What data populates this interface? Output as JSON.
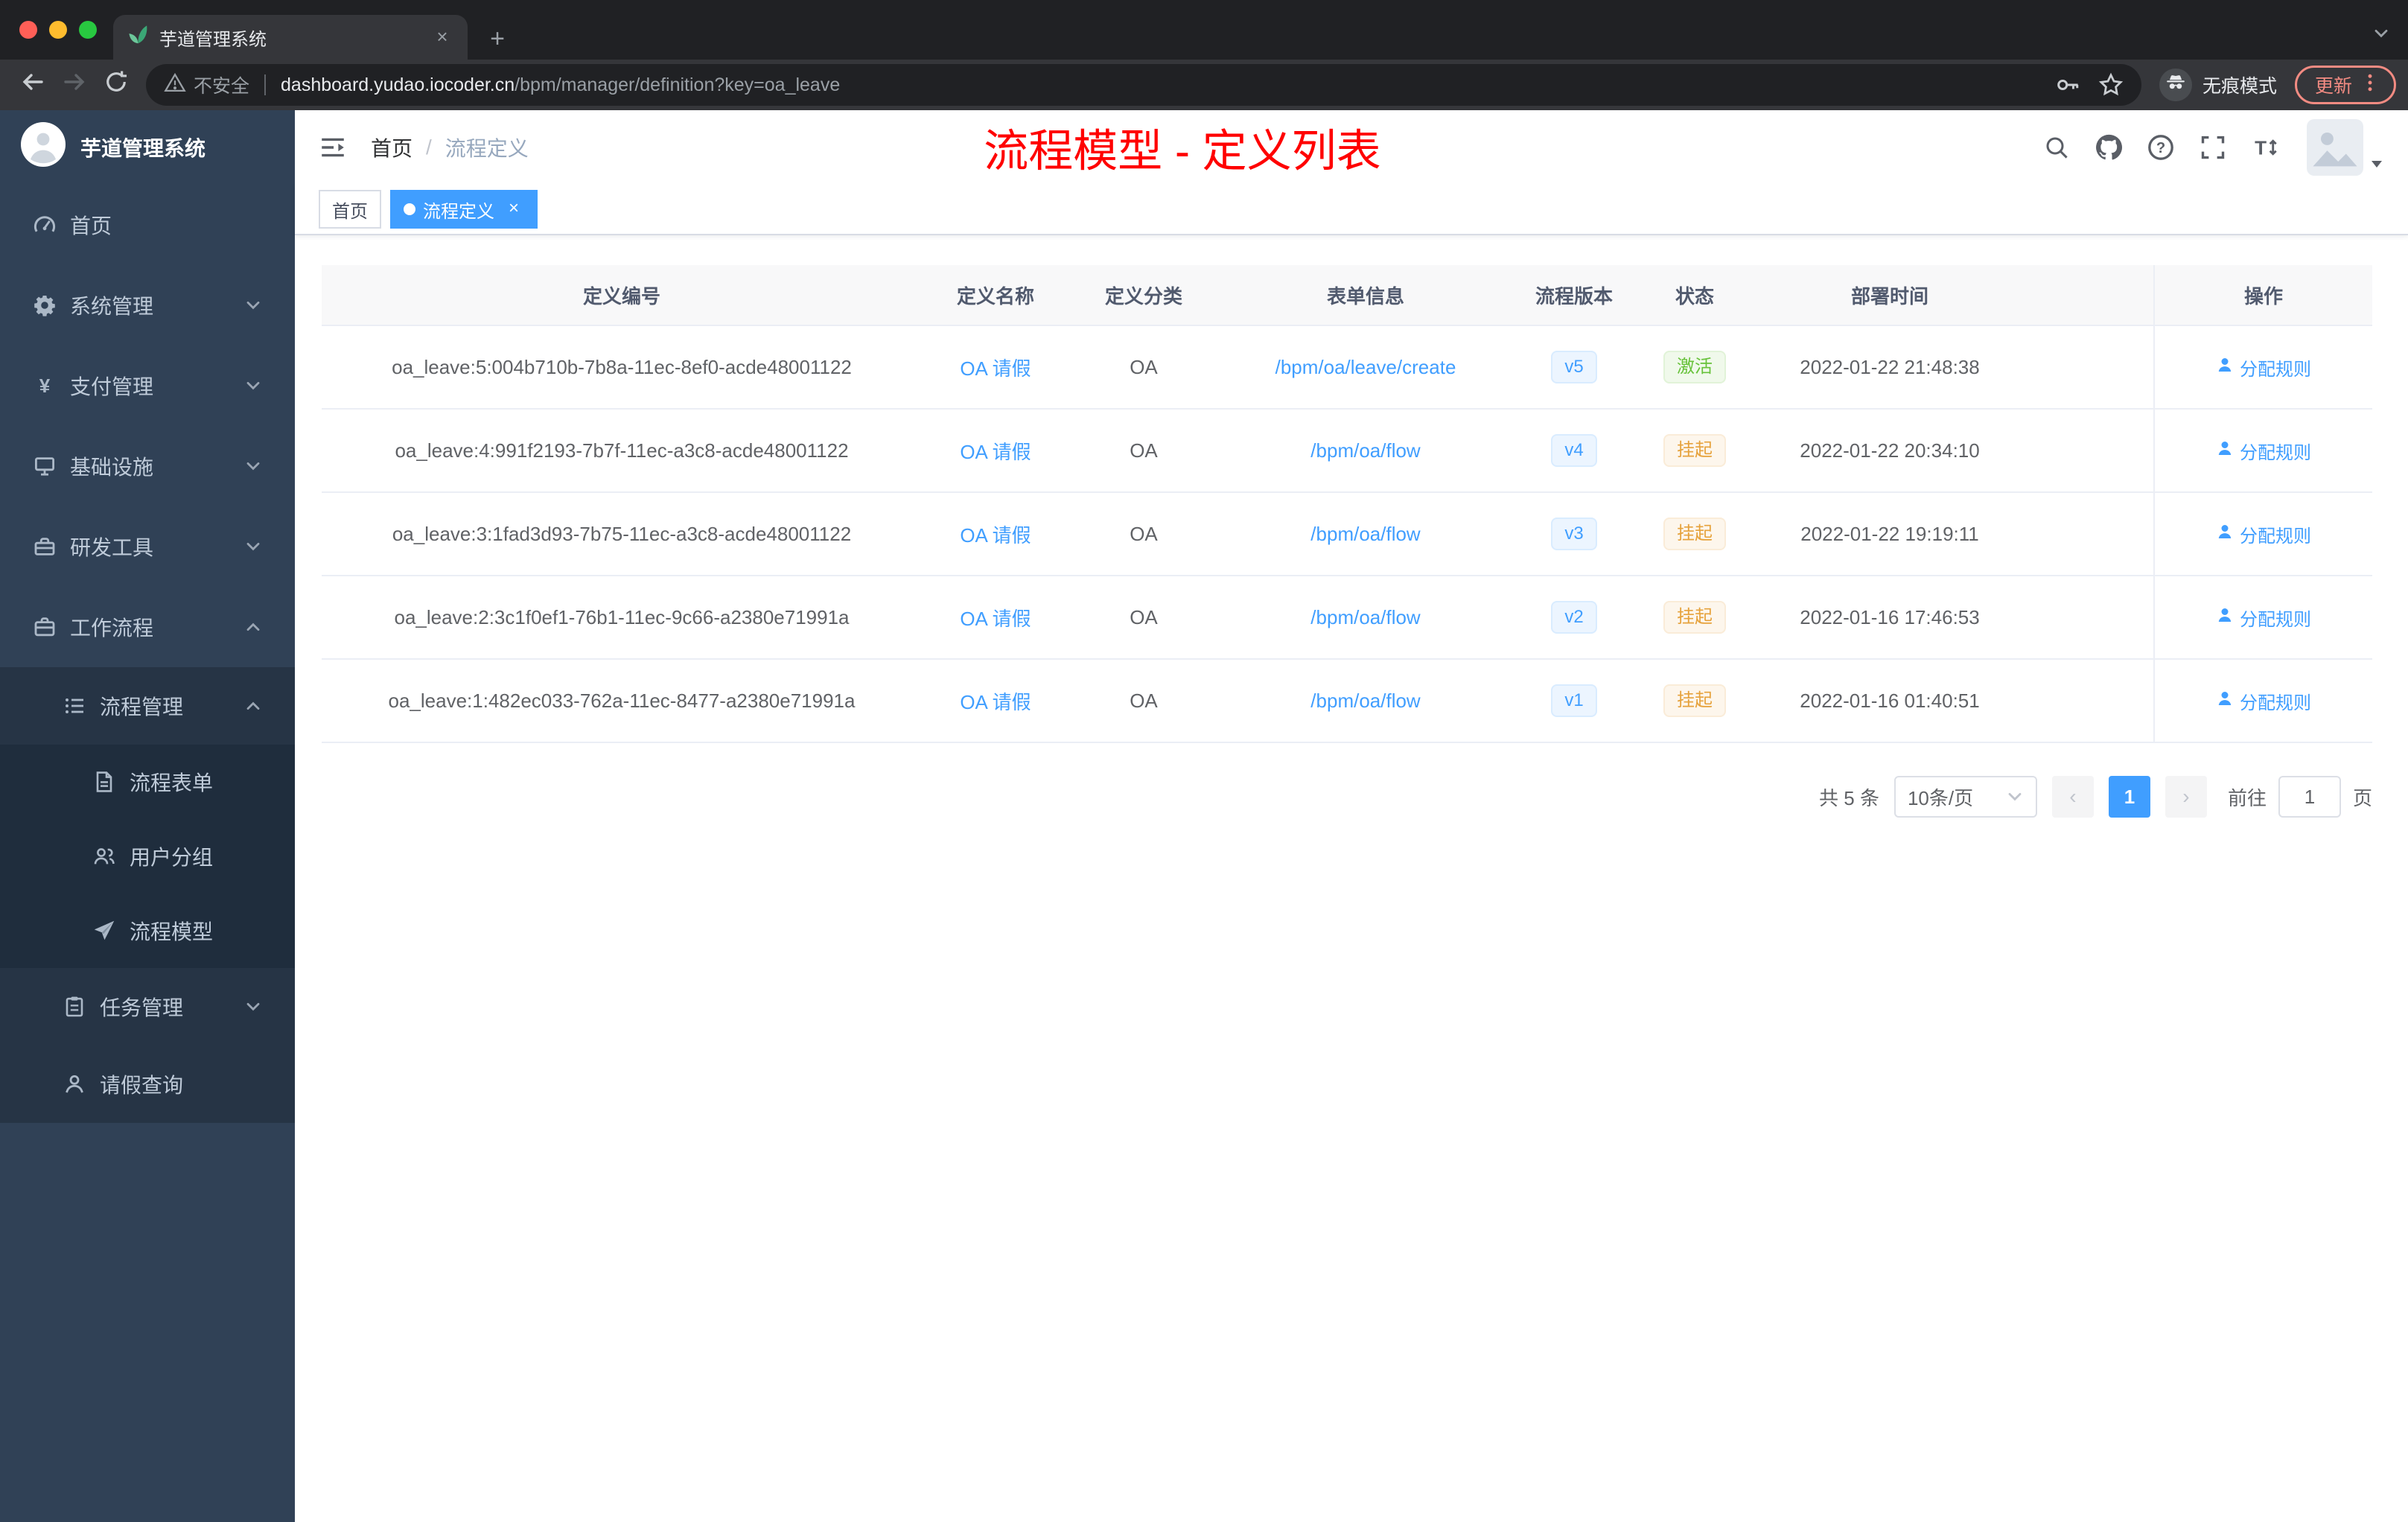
{
  "browser": {
    "tab_title": "芋道管理系统",
    "not_secure": "不安全",
    "url_host": "dashboard.yudao.iocoder.cn",
    "url_path": "/bpm/manager/definition?key=oa_leave",
    "incognito_label": "无痕模式",
    "update_label": "更新"
  },
  "sidebar": {
    "title": "芋道管理系统",
    "items": [
      {
        "label": "首页",
        "icon": "dashboard-icon",
        "level": 1
      },
      {
        "label": "系统管理",
        "icon": "gear-icon",
        "level": 1,
        "chevron": "down"
      },
      {
        "label": "支付管理",
        "icon": "yen-icon",
        "level": 1,
        "chevron": "down"
      },
      {
        "label": "基础设施",
        "icon": "server-icon",
        "level": 1,
        "chevron": "down"
      },
      {
        "label": "研发工具",
        "icon": "toolbox-icon",
        "level": 1,
        "chevron": "down"
      },
      {
        "label": "工作流程",
        "icon": "briefcase-icon",
        "level": 1,
        "chevron": "up"
      },
      {
        "label": "流程管理",
        "icon": "list-icon",
        "level": 2,
        "chevron": "up"
      },
      {
        "label": "流程表单",
        "icon": "document-icon",
        "level": 3
      },
      {
        "label": "用户分组",
        "icon": "users-icon",
        "level": 3
      },
      {
        "label": "流程模型",
        "icon": "paper-plane-icon",
        "level": 3
      },
      {
        "label": "任务管理",
        "icon": "clipboard-icon",
        "level": 2,
        "chevron": "down"
      },
      {
        "label": "请假查询",
        "icon": "user-icon",
        "level": 2
      }
    ]
  },
  "header": {
    "breadcrumb_home": "首页",
    "breadcrumb_sep": "/",
    "breadcrumb_current": "流程定义",
    "annotation": "流程模型 - 定义列表"
  },
  "tags": [
    {
      "label": "首页",
      "active": false,
      "closable": false
    },
    {
      "label": "流程定义",
      "active": true,
      "closable": true
    }
  ],
  "table": {
    "columns": [
      "定义编号",
      "定义名称",
      "定义分类",
      "表单信息",
      "流程版本",
      "状态",
      "部署时间",
      "操作"
    ],
    "rows": [
      {
        "id": "oa_leave:5:004b710b-7b8a-11ec-8ef0-acde48001122",
        "name": "OA 请假",
        "category": "OA",
        "form": "/bpm/oa/leave/create",
        "version": "v5",
        "status": "激活",
        "status_type": "success",
        "deploy_time": "2022-01-22 21:48:38",
        "action": "分配规则"
      },
      {
        "id": "oa_leave:4:991f2193-7b7f-11ec-a3c8-acde48001122",
        "name": "OA 请假",
        "category": "OA",
        "form": "/bpm/oa/flow",
        "version": "v4",
        "status": "挂起",
        "status_type": "warning",
        "deploy_time": "2022-01-22 20:34:10",
        "action": "分配规则"
      },
      {
        "id": "oa_leave:3:1fad3d93-7b75-11ec-a3c8-acde48001122",
        "name": "OA 请假",
        "category": "OA",
        "form": "/bpm/oa/flow",
        "version": "v3",
        "status": "挂起",
        "status_type": "warning",
        "deploy_time": "2022-01-22 19:19:11",
        "action": "分配规则"
      },
      {
        "id": "oa_leave:2:3c1f0ef1-76b1-11ec-9c66-a2380e71991a",
        "name": "OA 请假",
        "category": "OA",
        "form": "/bpm/oa/flow",
        "version": "v2",
        "status": "挂起",
        "status_type": "warning",
        "deploy_time": "2022-01-16 17:46:53",
        "action": "分配规则"
      },
      {
        "id": "oa_leave:1:482ec033-762a-11ec-8477-a2380e71991a",
        "name": "OA 请假",
        "category": "OA",
        "form": "/bpm/oa/flow",
        "version": "v1",
        "status": "挂起",
        "status_type": "warning",
        "deploy_time": "2022-01-16 01:40:51",
        "action": "分配规则"
      }
    ]
  },
  "pagination": {
    "total": "共 5 条",
    "page_size": "10条/页",
    "current": "1",
    "goto_label": "前往",
    "goto_value": "1",
    "goto_unit": "页"
  },
  "colors": {
    "accent": "#409eff",
    "sidebar_bg": "#304156",
    "annotation_red": "#ff0000",
    "success": "#67c23a",
    "warning": "#e6a23c"
  }
}
